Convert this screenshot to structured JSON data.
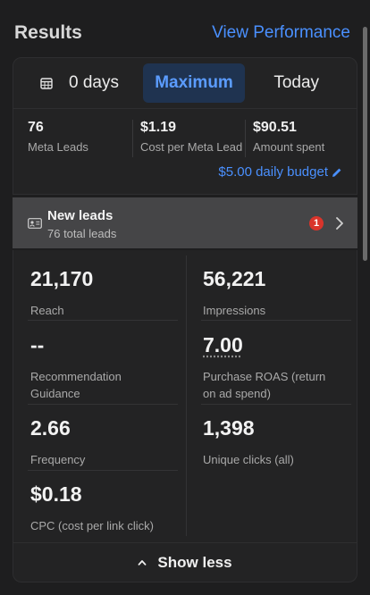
{
  "header": {
    "title": "Results",
    "link": "View Performance"
  },
  "range": {
    "options": [
      "0 days",
      "Maximum",
      "Today"
    ],
    "selected": "Maximum"
  },
  "summary": [
    {
      "value": "76",
      "label": "Meta Leads"
    },
    {
      "value": "$1.19",
      "label": "Cost per Meta Lead"
    },
    {
      "value": "$90.51",
      "label": "Amount spent"
    }
  ],
  "budget": "$5.00 daily budget",
  "leads": {
    "title": "New leads",
    "subtitle": "76 total leads",
    "badge": "1"
  },
  "metrics": [
    {
      "value": "21,170",
      "label": "Reach"
    },
    {
      "value": "56,221",
      "label": "Impressions"
    },
    {
      "value": "--",
      "label": "Recommendation Guidance"
    },
    {
      "value": "7.00",
      "label": "Purchase ROAS (return on ad spend)"
    },
    {
      "value": "2.66",
      "label": "Frequency"
    },
    {
      "value": "1,398",
      "label": "Unique clicks (all)"
    },
    {
      "value": "$0.18",
      "label": "CPC (cost per link click)"
    }
  ],
  "show_less": "Show less",
  "colors": {
    "accent": "#4a90ff",
    "background": "#1e1e1f",
    "badge": "#d9342b"
  },
  "icons": [
    "calendar-icon",
    "edit-pencil-icon",
    "lead-card-icon",
    "chevron-right-icon",
    "caret-up-icon"
  ]
}
